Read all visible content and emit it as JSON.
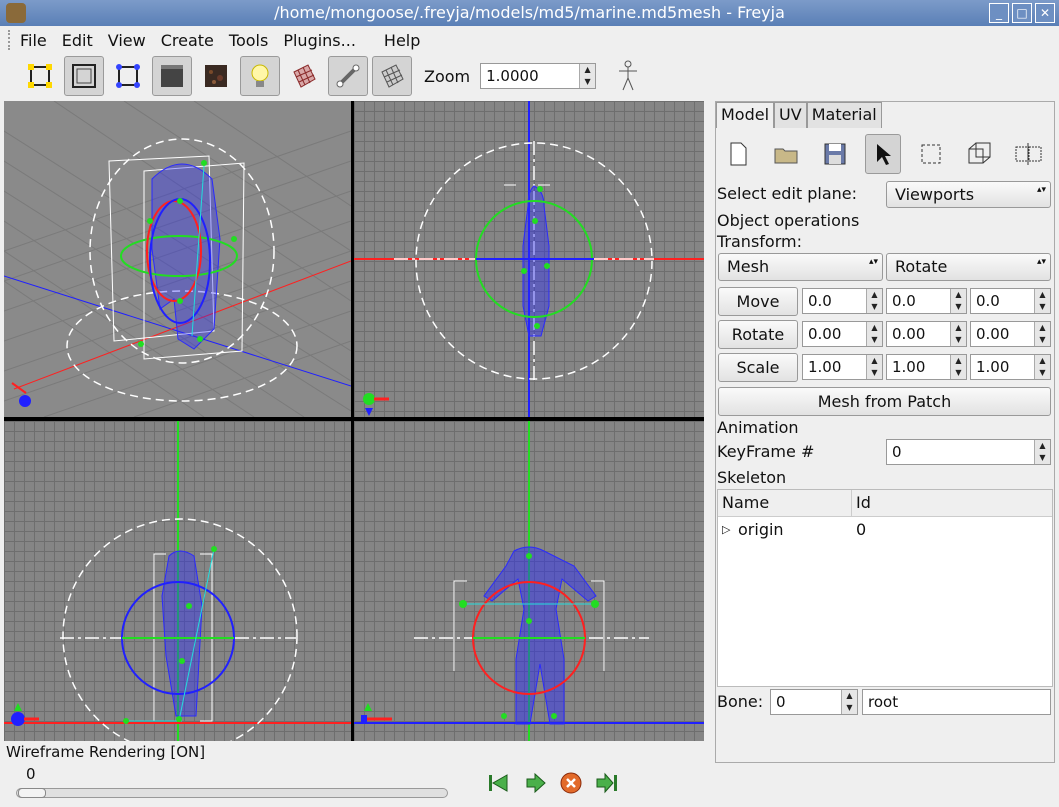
{
  "window": {
    "title": "/home/mongoose/.freyja/models/md5/marine.md5mesh - Freyja"
  },
  "menu": [
    "File",
    "Edit",
    "View",
    "Create",
    "Tools",
    "Plugins...",
    "Help"
  ],
  "toolbar": {
    "icons": [
      "bounding-box-icon",
      "mesh-box-icon",
      "vertex-box-icon",
      "solid-box-icon",
      "texture-icon",
      "light-bulb-icon",
      "material-grid-icon",
      "bone-icon",
      "wireframe-grid-icon",
      "skeleton-figure-icon"
    ],
    "zoom_label": "Zoom",
    "zoom_value": "1.0000"
  },
  "status": {
    "text": "Wireframe Rendering [ON]"
  },
  "timeline": {
    "frame": "0",
    "position": 0
  },
  "tabs": [
    "Model",
    "UV",
    "Material"
  ],
  "panel": {
    "edit_plane_label": "Select edit plane:",
    "edit_plane_value": "Viewports",
    "object_ops": "Object operations",
    "transform_label": "Transform:",
    "transform_target": "Mesh",
    "transform_mode": "Rotate",
    "move": {
      "label": "Move",
      "values": [
        "0.0",
        "0.0",
        "0.0"
      ]
    },
    "rotate": {
      "label": "Rotate",
      "values": [
        "0.00",
        "0.00",
        "0.00"
      ]
    },
    "scale": {
      "label": "Scale",
      "values": [
        "1.00",
        "1.00",
        "1.00"
      ]
    },
    "mesh_from_patch": "Mesh from Patch",
    "animation": "Animation",
    "keyframe_label": "KeyFrame #",
    "keyframe_value": "0",
    "skeleton": "Skeleton",
    "col_name": "Name",
    "col_id": "Id",
    "row_name": "origin",
    "row_id": "0",
    "bone_label": "Bone:",
    "bone_value": "0",
    "bone_name": "root"
  },
  "colors": {
    "mesh": "#2a2aff",
    "joint": "#22dd22",
    "axis_red": "#ff2020",
    "axis_blue": "#2020ff",
    "axis_green": "#20cc20"
  }
}
